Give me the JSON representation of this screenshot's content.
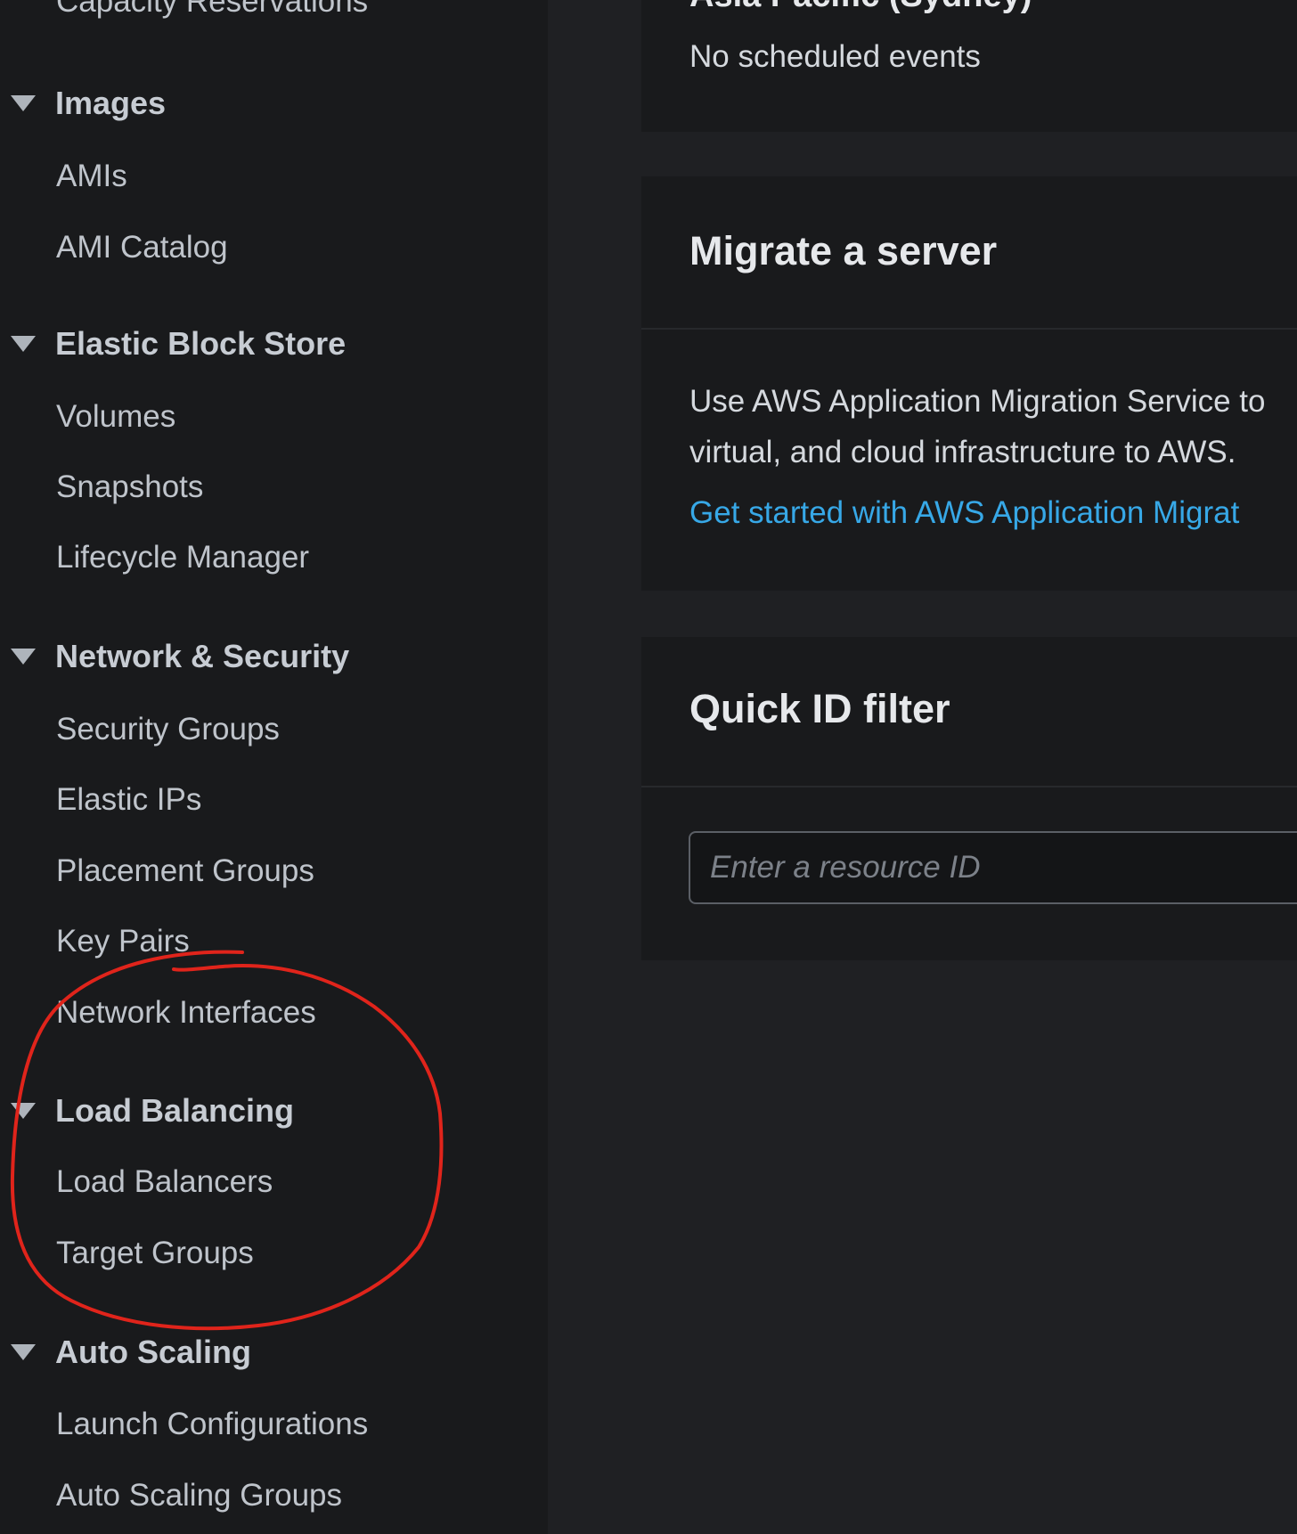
{
  "sidebar": {
    "top_partial_item": "Capacity Reservations",
    "sections": [
      {
        "title": "Images",
        "items": [
          "AMIs",
          "AMI Catalog"
        ]
      },
      {
        "title": "Elastic Block Store",
        "items": [
          "Volumes",
          "Snapshots",
          "Lifecycle Manager"
        ]
      },
      {
        "title": "Network & Security",
        "items": [
          "Security Groups",
          "Elastic IPs",
          "Placement Groups",
          "Key Pairs",
          "Network Interfaces"
        ]
      },
      {
        "title": "Load Balancing",
        "items": [
          "Load Balancers",
          "Target Groups"
        ]
      },
      {
        "title": "Auto Scaling",
        "items": [
          "Launch Configurations",
          "Auto Scaling Groups"
        ]
      }
    ]
  },
  "events_card": {
    "region_partial": "Asia Pacific (Sydney)",
    "status": "No scheduled events"
  },
  "migrate_card": {
    "title": "Migrate a server",
    "description_line1": "Use AWS Application Migration Service to",
    "description_line2": "virtual, and cloud infrastructure to AWS.",
    "link": "Get started with AWS Application Migrat"
  },
  "quick_id_filter": {
    "title": "Quick ID filter",
    "placeholder": "Enter a resource ID"
  },
  "annotation": {
    "color": "#e0241b"
  }
}
